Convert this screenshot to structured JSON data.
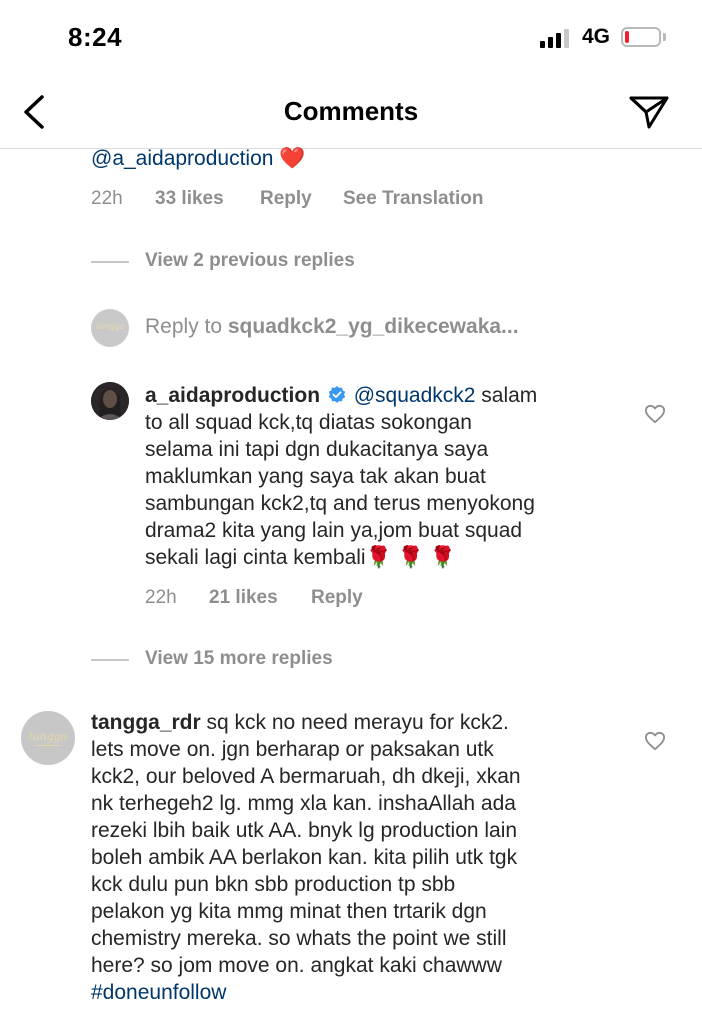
{
  "status": {
    "time": "8:24",
    "network": "4G"
  },
  "header": {
    "title": "Comments",
    "back_icon": "chevron-left-icon",
    "send_icon": "paper-plane-icon"
  },
  "top_comment": {
    "mention": "@a_aidaproduction",
    "emoji": "❤️",
    "time": "22h",
    "likes": "33 likes",
    "reply": "Reply",
    "translation": "See Translation"
  },
  "view_previous": "View 2 previous replies",
  "reply_bar": {
    "prefix": "Reply to ",
    "target": "squadkck2_yg_dikecewaka..."
  },
  "reply": {
    "username": "a_aidaproduction",
    "mention": "@squadkck2",
    "text_lines": [
      " salam",
      "to all squad kck,tq diatas sokongan",
      "selama ini tapi dgn dukacitanya saya",
      "maklumkan yang saya tak akan buat",
      "sambungan kck2,tq and terus menyokong",
      "drama2 kita yang lain ya,jom buat squad",
      "sekali lagi cinta kembali"
    ],
    "roses": "🌹 🌹 🌹",
    "time": "22h",
    "likes": "21 likes",
    "reply": "Reply"
  },
  "view_more": "View 15 more replies",
  "comment": {
    "username": "tangga_rdr",
    "avatar_text": "tangga",
    "text_lines": [
      " sq kck no need merayu for kck2.",
      "lets move on. jgn berharap or paksakan utk",
      "kck2, our beloved A bermaruah, dh dkeji, xkan",
      "nk terhegeh2 lg. mmg xla kan. inshaAllah ada",
      "rezeki lbih baik utk AA. bnyk lg production lain",
      "boleh ambik AA berlakon kan. kita pilih utk tgk",
      "kck dulu pun bkn sbb production tp sbb",
      "pelakon yg kita mmg minat then trtarik dgn",
      "chemistry mereka. so whats the point we still",
      "here? so jom move on. angkat kaki chawww"
    ],
    "hashtag": "#doneunfollow"
  },
  "colors": {
    "link": "#00376b",
    "meta": "#8e8e8e",
    "verified": "#3897f0",
    "battery_low": "#f21f2e"
  }
}
